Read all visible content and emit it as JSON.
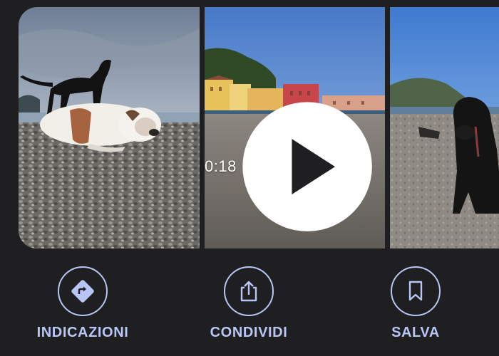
{
  "gallery": {
    "photos": [
      {
        "subject": "black dog and bulldog on pebble beach"
      },
      {
        "subject": "colorful houses on beach with small black dog",
        "video_duration": "0:18"
      },
      {
        "subject": "black labrador sitting on sandy beach"
      }
    ]
  },
  "actions": [
    {
      "label": "INDICAZIONI",
      "icon": "directions-icon"
    },
    {
      "label": "CONDIVIDI",
      "icon": "share-icon"
    },
    {
      "label": "SALVA",
      "icon": "bookmark-icon"
    }
  ],
  "colors": {
    "background": "#1f1f21",
    "accent": "#b9c6f5"
  }
}
